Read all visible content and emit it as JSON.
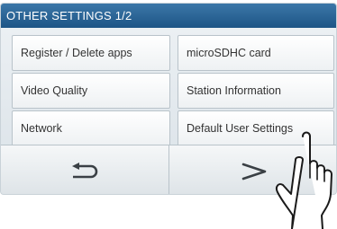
{
  "header": {
    "title": "OTHER SETTINGS 1/2"
  },
  "menu": {
    "left": [
      {
        "label": "Register / Delete apps"
      },
      {
        "label": "Video Quality"
      },
      {
        "label": "Network"
      }
    ],
    "right": [
      {
        "label": "microSDHC card"
      },
      {
        "label": "Station Information"
      },
      {
        "label": "Default User Settings"
      }
    ]
  },
  "nav": {
    "back_icon": "back-arrow-icon",
    "next_icon": "next-arrow-icon"
  },
  "overlay": {
    "icon": "pointing-hand-icon"
  },
  "colors": {
    "header": "#2a6497",
    "button_border": "#b9c3ca",
    "text": "#333333"
  }
}
